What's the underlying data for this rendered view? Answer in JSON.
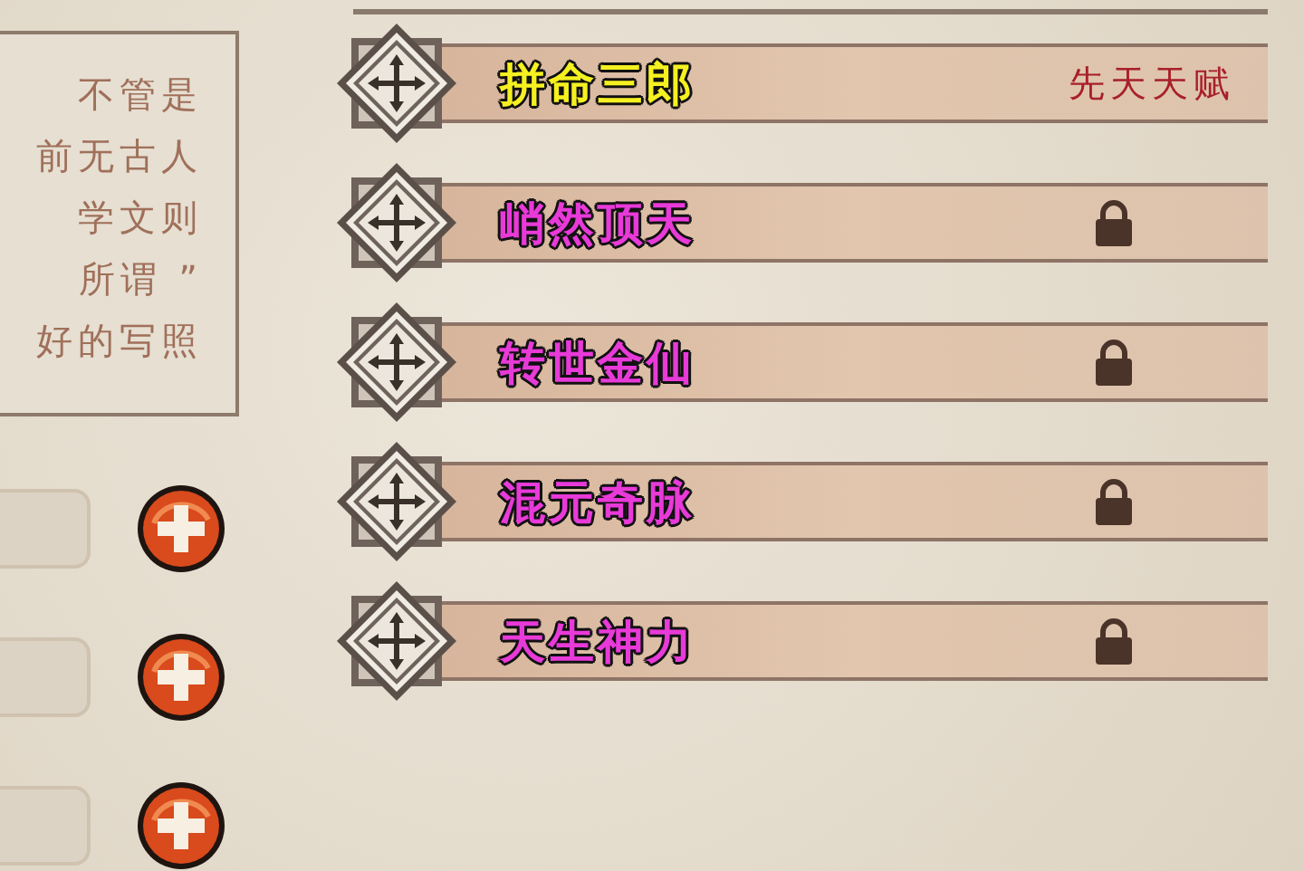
{
  "description": {
    "lines": [
      "不管是",
      "前无古人",
      "学文则",
      "所谓 ”",
      "好的写照"
    ]
  },
  "attribute_rows": [
    {
      "kind": "field"
    },
    {
      "kind": "field"
    },
    {
      "kind": "field"
    }
  ],
  "talents": [
    {
      "name": "拼命三郎",
      "color": "#f5f020",
      "locked": false,
      "tag": "先天天赋"
    },
    {
      "name": "峭然顶天",
      "color": "#e83ad8",
      "locked": true
    },
    {
      "name": "转世金仙",
      "color": "#e83ad8",
      "locked": true
    },
    {
      "name": "混元奇脉",
      "color": "#e83ad8",
      "locked": true
    },
    {
      "name": "天生神力",
      "color": "#e83ad8",
      "locked": true
    }
  ]
}
